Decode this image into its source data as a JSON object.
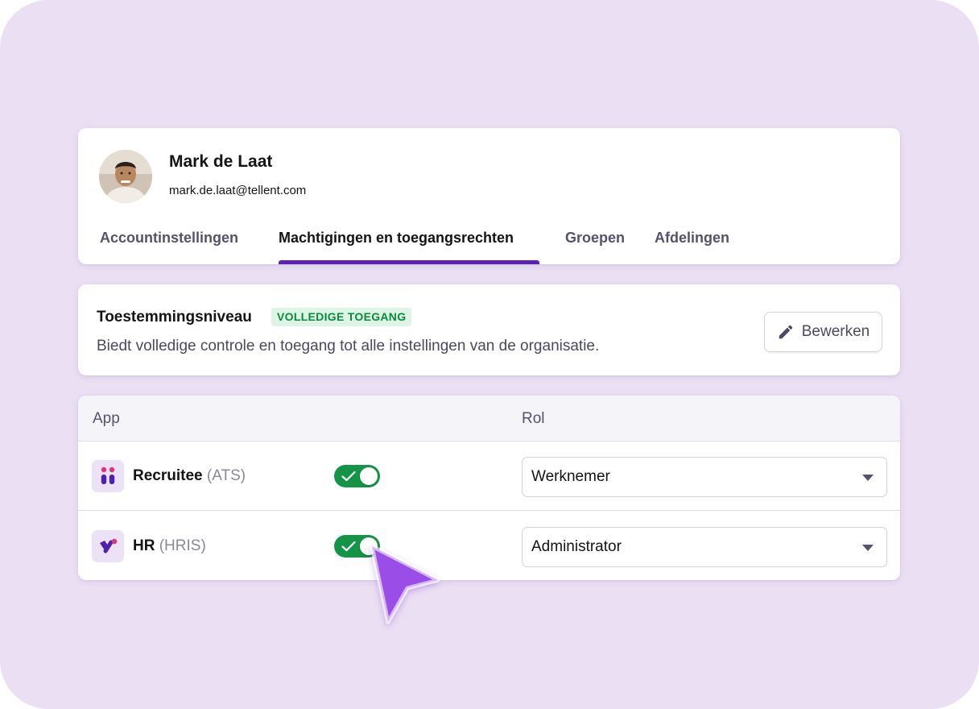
{
  "profile": {
    "name": "Mark de Laat",
    "email": "mark.de.laat@tellent.com",
    "avatar_icon": "user-avatar"
  },
  "tabs": [
    {
      "label": "Accountinstellingen",
      "active": false
    },
    {
      "label": "Machtigingen en toegangsrechten",
      "active": true
    },
    {
      "label": "Groepen",
      "active": false
    },
    {
      "label": "Afdelingen",
      "active": false
    }
  ],
  "permission": {
    "title": "Toestemmingsniveau",
    "badge": "VOLLEDIGE TOEGANG",
    "description": "Biedt volledige controle en toegang tot alle instellingen van de organisatie.",
    "edit_label": "Bewerken",
    "edit_icon": "pencil-icon"
  },
  "apps_table": {
    "headers": {
      "app": "App",
      "role": "Rol"
    },
    "rows": [
      {
        "name": "Recruitee",
        "abbr": "(ATS)",
        "icon": "recruitee-logo-icon",
        "enabled": true,
        "role": "Werknemer"
      },
      {
        "name": "HR",
        "abbr": "(HRIS)",
        "icon": "hr-logo-icon",
        "enabled": true,
        "role": "Administrator"
      }
    ]
  },
  "colors": {
    "background": "#ebdff4",
    "accent": "#5b21b6",
    "toggle_on": "#149447",
    "badge_text": "#0b8a3e",
    "badge_bg": "#dcf5e4",
    "cursor": "#9b4de8"
  }
}
